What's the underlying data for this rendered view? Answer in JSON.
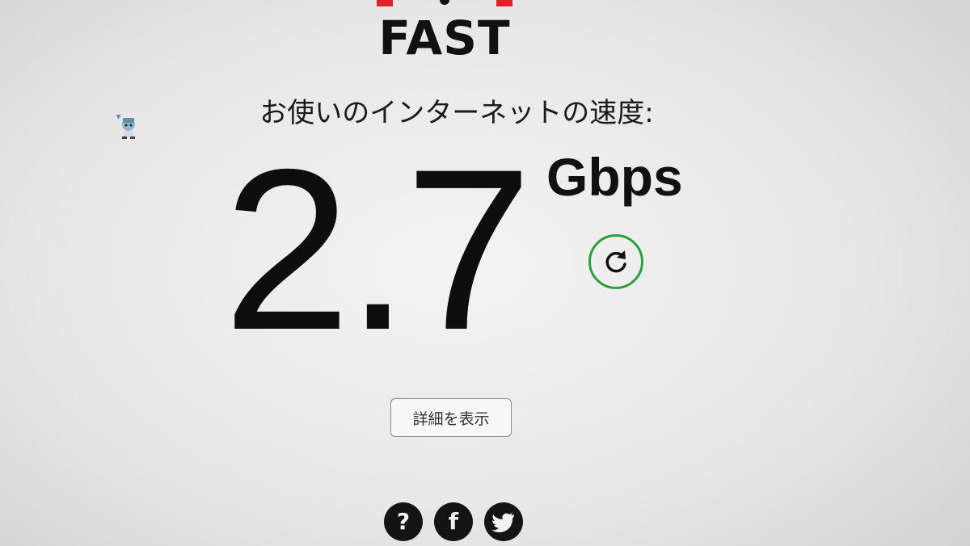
{
  "logo": {
    "wordmark": "FAST",
    "icon": "fast-logo-speedometer-icon",
    "accent_color": "#e0202a"
  },
  "desktop": {
    "icon": "desktop-character-icon"
  },
  "speed": {
    "label": "お使いのインターネットの速度:",
    "value": "2.7",
    "unit": "Gbps"
  },
  "retry": {
    "icon": "refresh-icon",
    "color": "#2aa03a"
  },
  "details": {
    "label": "詳細を表示"
  },
  "footer": {
    "help_glyph": "?",
    "facebook_glyph": "f",
    "icons": [
      "help-icon",
      "facebook-icon",
      "twitter-icon"
    ]
  }
}
